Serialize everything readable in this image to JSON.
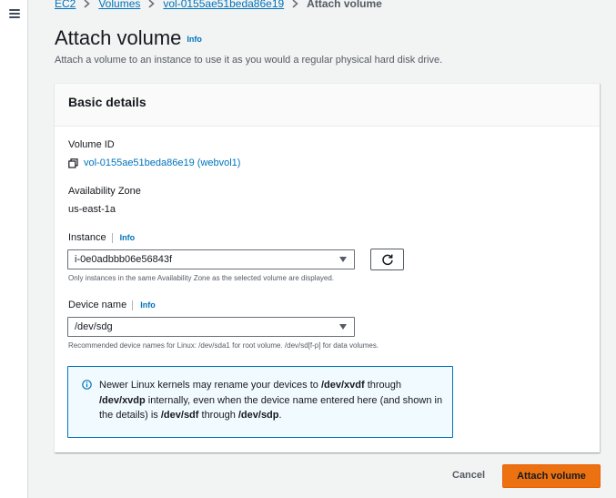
{
  "breadcrumb": {
    "items": [
      "EC2",
      "Volumes",
      "vol-0155ae51beda86e19"
    ],
    "current": "Attach volume"
  },
  "page": {
    "title": "Attach volume",
    "info": "Info",
    "description": "Attach a volume to an instance to use it as you would a regular physical hard disk drive."
  },
  "panel": {
    "title": "Basic details",
    "volume_id": {
      "label": "Volume ID",
      "value": "vol-0155ae51beda86e19 (webvol1)",
      "icon": "copy-icon"
    },
    "availability_zone": {
      "label": "Availability Zone",
      "value": "us-east-1a"
    },
    "instance": {
      "label": "Instance",
      "info": "Info",
      "selected": "i-0e0adbbb06e56843f",
      "hint": "Only instances in the same Availability Zone as the selected volume are displayed.",
      "refresh_icon": "refresh-icon"
    },
    "device_name": {
      "label": "Device name",
      "info": "Info",
      "selected": "/dev/sdg",
      "hint": "Recommended device names for Linux: /dev/sda1 for root volume. /dev/sd[f-p] for data volumes."
    },
    "alert": {
      "icon": "info-circle-icon",
      "segments": [
        "Newer Linux kernels may rename your devices to ",
        "/dev/xvdf",
        " through ",
        "/dev/xvdp",
        " internally, even when the device name entered here (and shown in the details) is ",
        "/dev/sdf",
        " through ",
        "/dev/sdp",
        "."
      ]
    }
  },
  "footer": {
    "cancel_label": "Cancel",
    "submit_label": "Attach volume"
  },
  "colors": {
    "accent": "#0073bb",
    "primary_button": "#ec7211",
    "alert_background": "#f1faff"
  }
}
